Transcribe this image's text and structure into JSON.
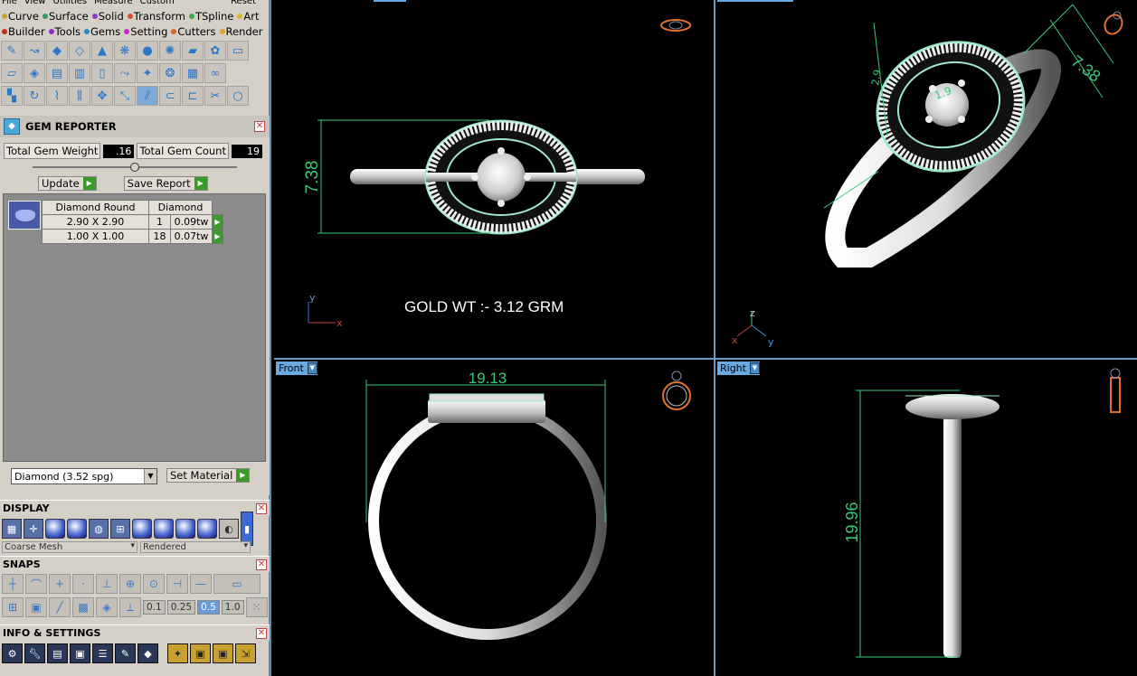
{
  "menu": [
    "File",
    "View",
    "Utilities",
    "Measure",
    "Custom",
    "Reset"
  ],
  "categories_row1": [
    {
      "label": "Curve",
      "color": "#c8a030"
    },
    {
      "label": "Surface",
      "color": "#3a9a6a"
    },
    {
      "label": "Solid",
      "color": "#8a3ac8"
    },
    {
      "label": "Transform",
      "color": "#d84a2a"
    },
    {
      "label": "TSpline",
      "color": "#3aa84a"
    },
    {
      "label": "Art",
      "color": "#d8b82a"
    }
  ],
  "categories_row2": [
    {
      "label": "Builder",
      "color": "#c82a2a"
    },
    {
      "label": "Tools",
      "color": "#8a2ac8"
    },
    {
      "label": "Gems",
      "color": "#2a8ac8"
    },
    {
      "label": "Setting",
      "color": "#c82ac8"
    },
    {
      "label": "Cutters",
      "color": "#d86a2a"
    },
    {
      "label": "Render",
      "color": "#d8a82a"
    }
  ],
  "gem_reporter": {
    "title": "GEM REPORTER",
    "total_weight_label": "Total Gem Weight",
    "total_weight": ".16",
    "total_count_label": "Total Gem Count",
    "total_count": "19",
    "update_label": "Update",
    "save_report_label": "Save Report",
    "table_headers": [
      "Diamond Round",
      "Diamond"
    ],
    "rows": [
      {
        "size": "2.90 X 2.90",
        "count": "1",
        "weight": "0.09tw"
      },
      {
        "size": "1.00 X 1.00",
        "count": "18",
        "weight": "0.07tw"
      }
    ],
    "material": "Diamond    (3.52 spg)",
    "set_material_label": "Set Material"
  },
  "display": {
    "title": "DISPLAY",
    "mesh": "Coarse Mesh",
    "render": "Rendered"
  },
  "snaps": {
    "title": "SNAPS",
    "values": [
      "0.1",
      "0.25",
      "0.5",
      "1.0"
    ],
    "selected": "0.5"
  },
  "info": {
    "title": "INFO & SETTINGS"
  },
  "viewports": {
    "top": {
      "gold_weight": "GOLD WT :- 3.12 GRM",
      "dim_height": "7.38",
      "axis_y": "y",
      "axis_x": "x"
    },
    "perspective": {
      "dim_width": "7.38",
      "dim_small": "2.9",
      "dim_small2": "1.9",
      "axis_z": "z",
      "axis_x": "x",
      "axis_y": "y"
    },
    "front": {
      "label": "Front",
      "dim_width": "19.13"
    },
    "right": {
      "label": "Right",
      "dim_height": "19.96"
    }
  },
  "colors": {
    "dimension": "#3ac87a",
    "viewport_border": "#6a9ac0",
    "label_bg": "#6aa8e0"
  }
}
